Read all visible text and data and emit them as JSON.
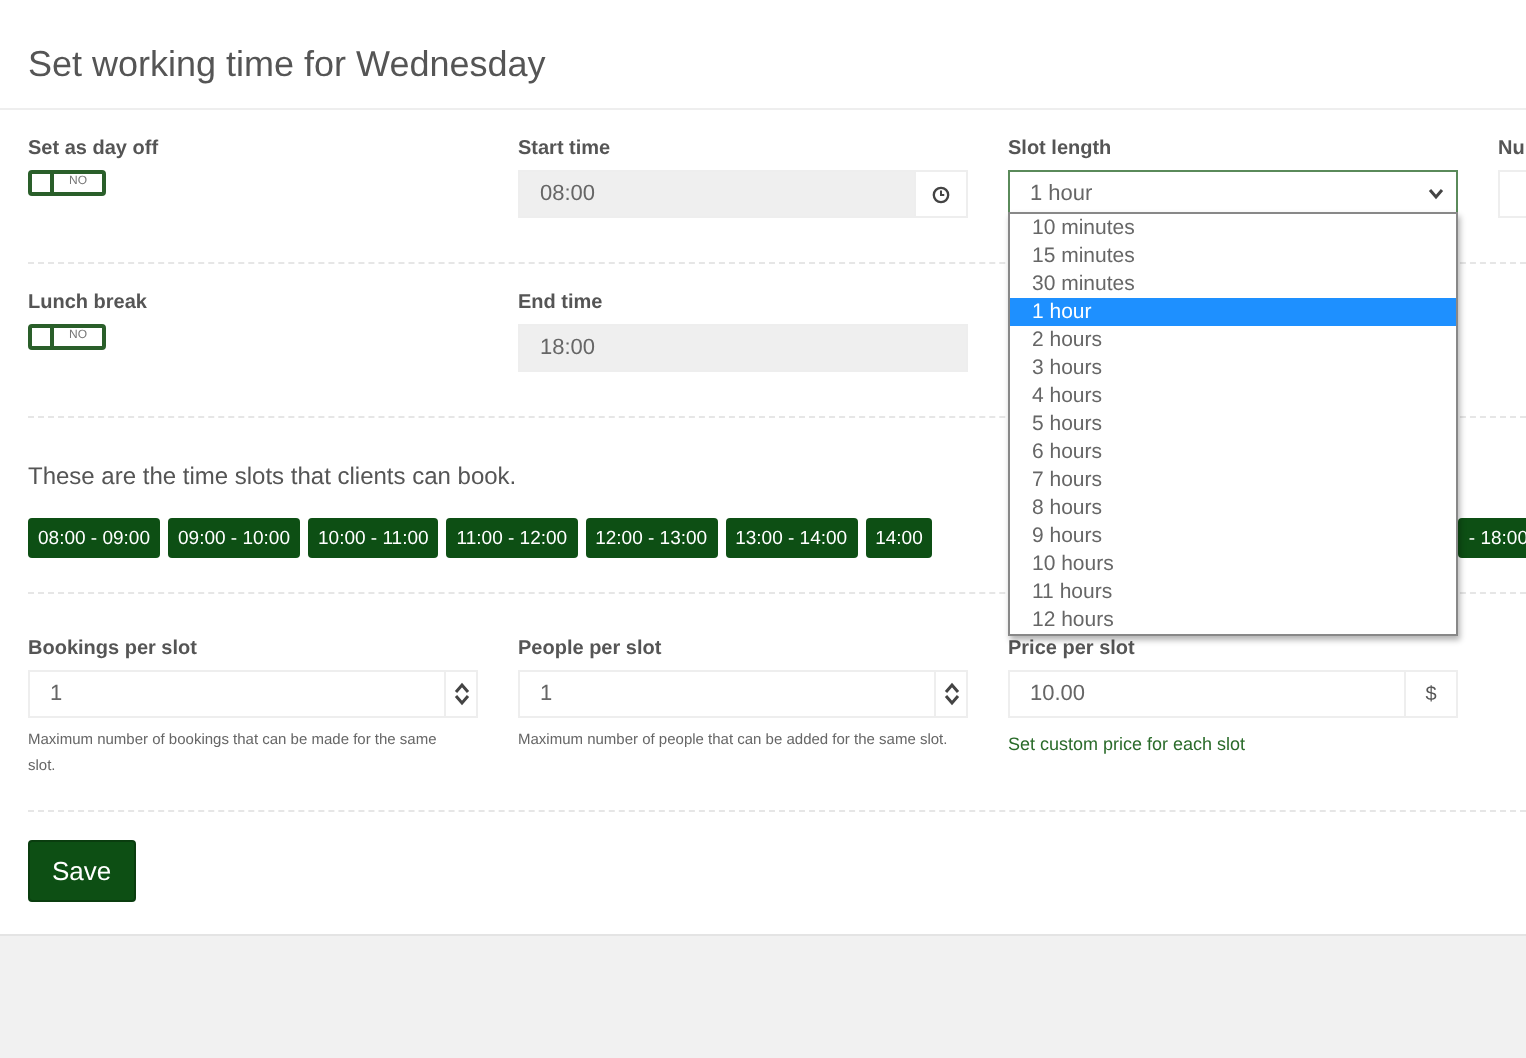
{
  "title": "Set working time for Wednesday",
  "day_off": {
    "label": "Set as day off",
    "on": false,
    "state_text": "NO"
  },
  "start_time": {
    "label": "Start time",
    "value": "08:00"
  },
  "slot_length": {
    "label": "Slot length",
    "value": "1 hour",
    "open": true,
    "options": [
      {
        "label": "10 minutes",
        "selected": false
      },
      {
        "label": "15 minutes",
        "selected": false
      },
      {
        "label": "30 minutes",
        "selected": false
      },
      {
        "label": "1 hour",
        "selected": true
      },
      {
        "label": "2 hours",
        "selected": false
      },
      {
        "label": "3 hours",
        "selected": false
      },
      {
        "label": "4 hours",
        "selected": false
      },
      {
        "label": "5 hours",
        "selected": false
      },
      {
        "label": "6 hours",
        "selected": false
      },
      {
        "label": "7 hours",
        "selected": false
      },
      {
        "label": "8 hours",
        "selected": false
      },
      {
        "label": "9 hours",
        "selected": false
      },
      {
        "label": "10 hours",
        "selected": false
      },
      {
        "label": "11 hours",
        "selected": false
      },
      {
        "label": "12 hours",
        "selected": false
      }
    ]
  },
  "column_4": {
    "label": "Nu"
  },
  "lunch_break": {
    "label": "Lunch break",
    "on": false,
    "state_text": "NO"
  },
  "end_time": {
    "label": "End time",
    "value": "18:00"
  },
  "slots_heading": "These are the time slots that clients can book.",
  "slots": [
    "08:00 - 09:00",
    "09:00 - 10:00",
    "10:00 - 11:00",
    "11:00 - 12:00",
    "12:00 - 13:00",
    "13:00 - 14:00",
    "14:00"
  ],
  "last_slot": "- 18:00",
  "bookings_per_slot": {
    "label": "Bookings per slot",
    "value": "1",
    "help": "Maximum number of bookings that can be made for the same slot."
  },
  "people_per_slot": {
    "label": "People per slot",
    "value": "1",
    "help": "Maximum number of people that can be added for the same slot."
  },
  "price_per_slot": {
    "label": "Price per slot",
    "value": "10.00",
    "unit": "$",
    "link": "Set custom price for each slot"
  },
  "save": "Save"
}
